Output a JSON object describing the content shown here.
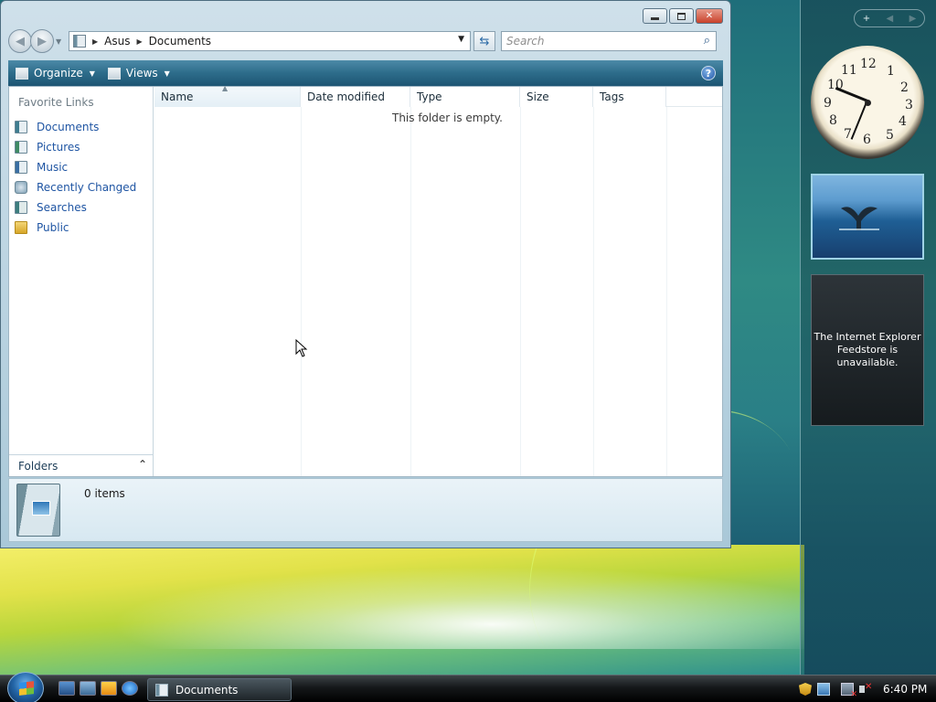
{
  "window": {
    "address": {
      "crumbs": [
        "Asus",
        "Documents"
      ]
    },
    "search": {
      "placeholder": "Search"
    },
    "toolbar": {
      "organize_label": "Organize",
      "views_label": "Views",
      "help_label": "?"
    },
    "nav_pane": {
      "favorites_title": "Favorite Links",
      "links": [
        {
          "label": "Documents",
          "icon": "documents-icon"
        },
        {
          "label": "Pictures",
          "icon": "pictures-icon"
        },
        {
          "label": "Music",
          "icon": "music-icon"
        },
        {
          "label": "Recently Changed",
          "icon": "recently-changed-icon"
        },
        {
          "label": "Searches",
          "icon": "searches-icon"
        },
        {
          "label": "Public",
          "icon": "public-folder-icon"
        }
      ],
      "folders_label": "Folders"
    },
    "columns": [
      "Name",
      "Date modified",
      "Type",
      "Size",
      "Tags"
    ],
    "empty_message": "This folder is empty.",
    "details": {
      "item_count": "0 items"
    }
  },
  "gadgets": {
    "clock": {
      "numbers": [
        "12",
        "1",
        "2",
        "3",
        "4",
        "5",
        "6",
        "7",
        "8",
        "9",
        "10",
        "11"
      ]
    },
    "slideshow": {
      "subject": "whale-tail-photo"
    },
    "feed": {
      "message": "The Internet Explorer Feedstore is unavailable."
    }
  },
  "taskbar": {
    "task_label": "Documents",
    "time": "6:40 PM"
  },
  "colors": {
    "link": "#1f55a3",
    "toolbar": "#2d6c8a",
    "close_button": "#c8412b"
  }
}
